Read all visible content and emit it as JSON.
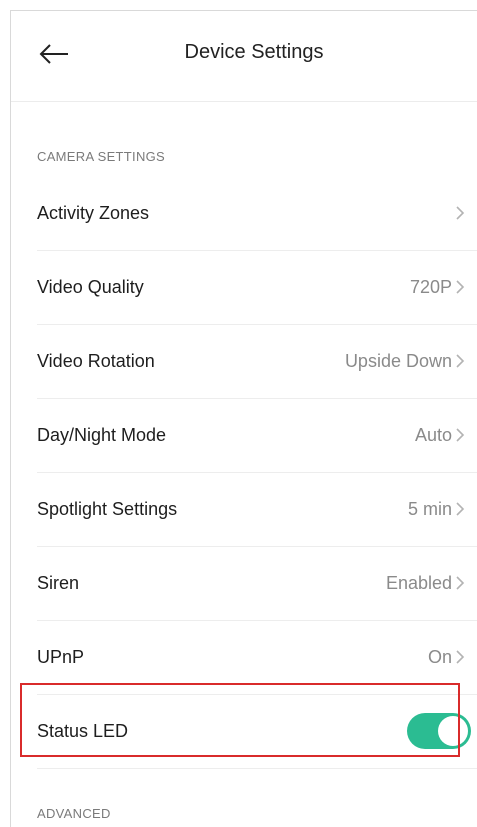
{
  "header": {
    "title": "Device Settings"
  },
  "sections": {
    "camera_settings": "CAMERA SETTINGS",
    "advanced": "ADVANCED"
  },
  "rows": [
    {
      "label": "Activity Zones",
      "value": ""
    },
    {
      "label": "Video Quality",
      "value": "720P"
    },
    {
      "label": "Video Rotation",
      "value": "Upside Down"
    },
    {
      "label": "Day/Night Mode",
      "value": "Auto"
    },
    {
      "label": "Spotlight Settings",
      "value": "5 min"
    },
    {
      "label": "Siren",
      "value": "Enabled"
    },
    {
      "label": "UPnP",
      "value": "On"
    }
  ],
  "status_led": {
    "label": "Status LED",
    "enabled": true
  },
  "colors": {
    "toggle_on": "#2bbc92",
    "highlight": "#d92b2b"
  }
}
